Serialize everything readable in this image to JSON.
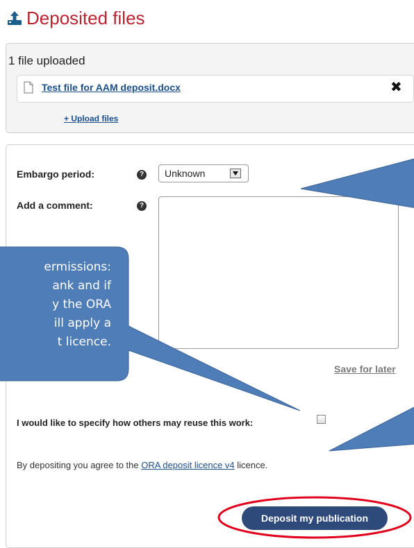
{
  "header": {
    "title": "Deposited files",
    "icon": "upload-icon",
    "accent": "#b8242f"
  },
  "upload": {
    "count_text": "1 file uploaded",
    "file_name": "Test file for AAM deposit.docx",
    "remove_symbol": "✖",
    "upload_link": "+ Upload files"
  },
  "form": {
    "embargo_label": "Embargo period:",
    "embargo_value": "Unknown",
    "comment_label": "Add a comment:",
    "help_symbol": "?",
    "save_later": "Save for later",
    "reuse_label": "I would like to specify how others may reuse this work:",
    "agree_prefix": "By depositing you agree to the ",
    "agree_link": "ORA deposit licence v4",
    "agree_suffix": " licence.",
    "deposit_button": "Deposit my publication"
  },
  "callout": {
    "lines": [
      "ermissions:",
      "ank and if",
      "y the ORA",
      "ill apply a",
      "t licence."
    ],
    "color": "#4f7db8",
    "highlight_color": "#e0001b"
  }
}
